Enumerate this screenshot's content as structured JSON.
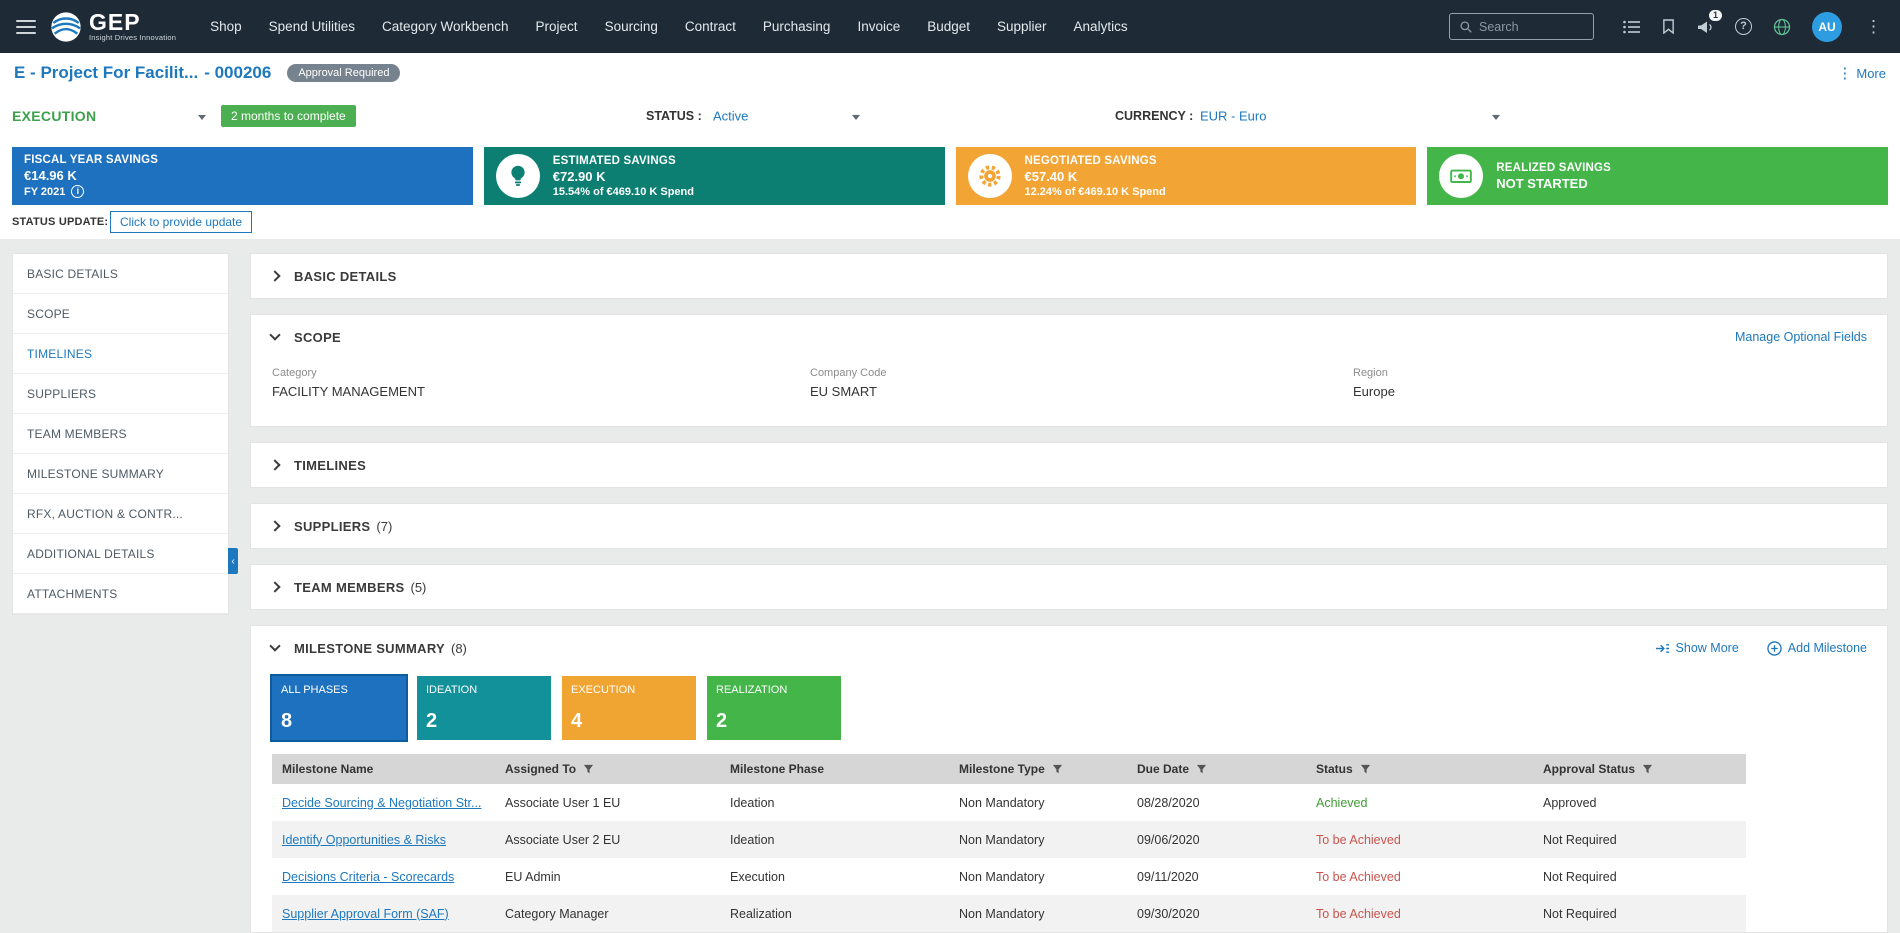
{
  "colors": {
    "navbar_bg": "#1e2b36",
    "accent_blue": "#1d78be",
    "phase_green_text": "#3da04b",
    "kpi_blue": "#1e71bf",
    "kpi_teal": "#0c7f72",
    "kpi_orange": "#f2a434",
    "kpi_green": "#43b549",
    "phase_teal": "#12919a",
    "status_achieved_green": "#3f9c35",
    "status_tobe_red": "#c9544e"
  },
  "navbar": {
    "brand": "GEP",
    "tagline": "Insight Drives Innovation",
    "items": [
      "Shop",
      "Spend Utilities",
      "Category Workbench",
      "Project",
      "Sourcing",
      "Contract",
      "Purchasing",
      "Invoice",
      "Budget",
      "Supplier",
      "Analytics"
    ],
    "search_placeholder": "Search",
    "notification_count": "1",
    "avatar_initials": "AU"
  },
  "header": {
    "title": "E - Project For Facilit...",
    "project_number": "- 000206",
    "badge": "Approval Required",
    "more_label": "More"
  },
  "controls": {
    "phase": "EXECUTION",
    "duration_badge": "2 months to complete",
    "status_label": "STATUS :",
    "status_value": "Active",
    "currency_label": "CURRENCY :",
    "currency_value": "EUR - Euro"
  },
  "kpis": [
    {
      "title": "FISCAL YEAR SAVINGS",
      "amount": "€14.96 K",
      "sub": "FY 2021"
    },
    {
      "title": "ESTIMATED SAVINGS",
      "amount": "€72.90 K",
      "sub": "15.54% of €469.10 K Spend"
    },
    {
      "title": "NEGOTIATED SAVINGS",
      "amount": "€57.40 K",
      "sub": "12.24% of €469.10 K Spend"
    },
    {
      "title": "REALIZED SAVINGS",
      "amount": "NOT STARTED",
      "sub": ""
    }
  ],
  "status_update": {
    "label": "STATUS UPDATE:",
    "action": "Click to provide update"
  },
  "sidebar": {
    "items": [
      "BASIC DETAILS",
      "SCOPE",
      "TIMELINES",
      "SUPPLIERS",
      "TEAM MEMBERS",
      "MILESTONE SUMMARY",
      "RFX, AUCTION & CONTR...",
      "ADDITIONAL DETAILS",
      "ATTACHMENTS"
    ]
  },
  "sections": {
    "basic_details": {
      "title": "BASIC DETAILS"
    },
    "scope": {
      "title": "SCOPE",
      "manage_link": "Manage Optional Fields",
      "fields": [
        {
          "label": "Category",
          "value": "FACILITY MANAGEMENT"
        },
        {
          "label": "Company Code",
          "value": "EU SMART"
        },
        {
          "label": "Region",
          "value": "Europe"
        }
      ]
    },
    "timelines": {
      "title": "TIMELINES"
    },
    "suppliers": {
      "title": "SUPPLIERS",
      "count": "(7)"
    },
    "team_members": {
      "title": "TEAM MEMBERS",
      "count": "(5)"
    },
    "milestones": {
      "title": "MILESTONE SUMMARY",
      "count": "(8)",
      "show_more": "Show More",
      "add_milestone": "Add Milestone",
      "phases": [
        {
          "label": "ALL PHASES",
          "count": "8"
        },
        {
          "label": "IDEATION",
          "count": "2"
        },
        {
          "label": "EXECUTION",
          "count": "4"
        },
        {
          "label": "REALIZATION",
          "count": "2"
        }
      ],
      "table": {
        "columns": [
          {
            "label": "Milestone Name",
            "filter": false
          },
          {
            "label": "Assigned To",
            "filter": true
          },
          {
            "label": "Milestone Phase",
            "filter": false
          },
          {
            "label": "Milestone Type",
            "filter": true
          },
          {
            "label": "Due Date",
            "filter": true
          },
          {
            "label": "Status",
            "filter": true
          },
          {
            "label": "Approval Status",
            "filter": true
          }
        ],
        "rows": [
          {
            "name": "Decide Sourcing & Negotiation Str...",
            "assigned_to": "Associate User 1 EU",
            "phase": "Ideation",
            "type": "Non Mandatory",
            "due_date": "08/28/2020",
            "status": "Achieved",
            "approval": "Approved"
          },
          {
            "name": "Identify Opportunities & Risks",
            "assigned_to": "Associate User 2 EU",
            "phase": "Ideation",
            "type": "Non Mandatory",
            "due_date": "09/06/2020",
            "status": "To be Achieved",
            "approval": "Not Required"
          },
          {
            "name": "Decisions Criteria - Scorecards",
            "assigned_to": "EU Admin",
            "phase": "Execution",
            "type": "Non Mandatory",
            "due_date": "09/11/2020",
            "status": "To be Achieved",
            "approval": "Not Required"
          },
          {
            "name": "Supplier Approval Form (SAF)",
            "assigned_to": "Category Manager",
            "phase": "Realization",
            "type": "Non Mandatory",
            "due_date": "09/30/2020",
            "status": "To be Achieved",
            "approval": "Not Required"
          }
        ]
      }
    }
  },
  "icons": {
    "navbar": [
      "hamburger-icon",
      "gep-logo-icon",
      "search-icon",
      "list-icon",
      "bookmark-icon",
      "announcement-icon",
      "help-icon",
      "globe-icon",
      "kebab-menu-icon"
    ],
    "kpi": [
      "bulb-icon",
      "gears-icon",
      "money-icon",
      "info-icon"
    ],
    "table": [
      "filter-icon"
    ],
    "actions": [
      "show-more-icon",
      "add-icon",
      "chevron-icons"
    ]
  }
}
